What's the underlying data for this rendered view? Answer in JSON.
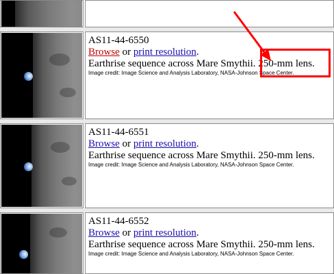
{
  "colors": {
    "annotation": "#ff0000",
    "link": "#1a0dab",
    "visited_link": "#c00000"
  },
  "entries": [
    {
      "id": "AS11-44-6550",
      "browse_label": "Browse",
      "or_text": "or",
      "print_label": "print resolution",
      "period": ".",
      "description": "Earthrise sequence across Mare Smythii. 250-mm lens.",
      "credit": "Image credit: Image Science and Analysis Laboratory, NASA-Johnson Space Center."
    },
    {
      "id": "AS11-44-6551",
      "browse_label": "Browse",
      "or_text": "or",
      "print_label": "print resolution",
      "period": ".",
      "description": "Earthrise sequence across Mare Smythii. 250-mm lens.",
      "credit": "Image credit: Image Science and Analysis Laboratory, NASA-Johnson Space Center."
    },
    {
      "id": "AS11-44-6552",
      "browse_label": "Browse",
      "or_text": "or",
      "print_label": "print resolution",
      "period": ".",
      "description": "Earthrise sequence across Mare Smythii. 250-mm lens.",
      "credit": "Image credit: Image Science and Analysis Laboratory, NASA-Johnson Space Center."
    }
  ]
}
